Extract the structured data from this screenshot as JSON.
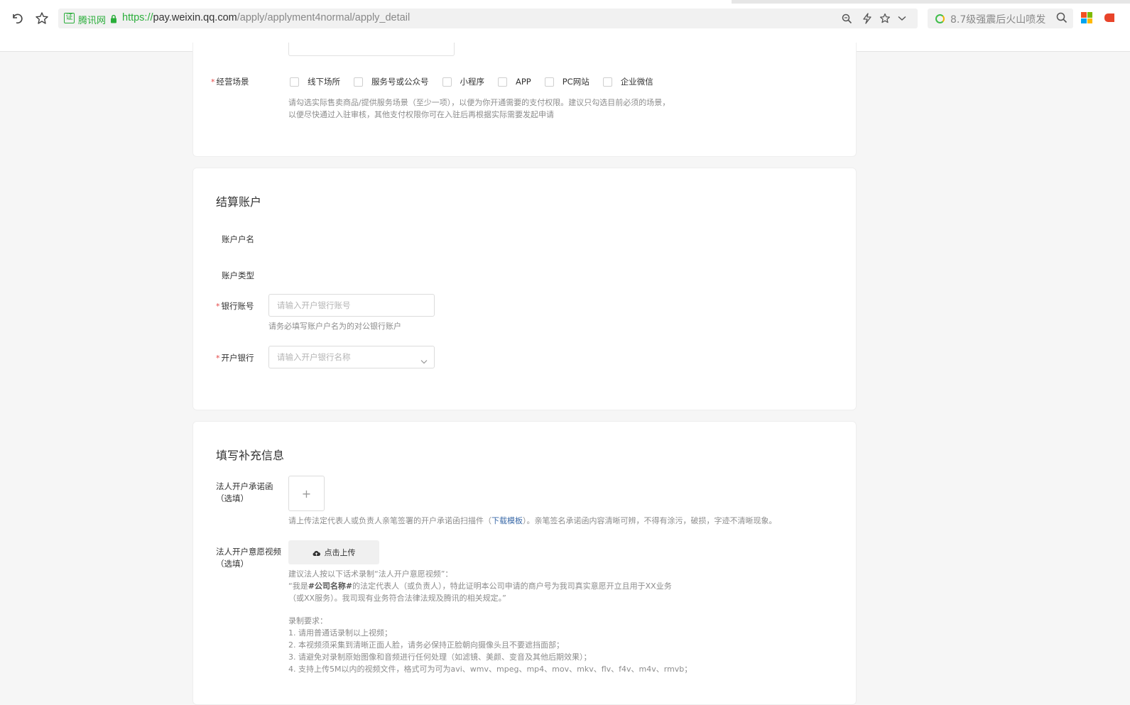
{
  "browser": {
    "cert_badge": "证",
    "cert_name": "腾讯网",
    "url_scheme": "https://",
    "url_host": "pay.weixin.qq.com",
    "url_path": "/apply/applyment4normal/apply_detail",
    "search_text": "8.7级强震后火山喷发"
  },
  "business_scene": {
    "label": "经营场景",
    "required_mark": "*",
    "options": [
      "线下场所",
      "服务号或公众号",
      "小程序",
      "APP",
      "PC网站",
      "企业微信"
    ],
    "hint_line1": "请勾选实际售卖商品/提供服务场景（至少一项），以便为你开通需要的支付权限。建议只勾选目前必须的场景，",
    "hint_line2": "以便尽快通过入驻审核，其他支付权限你可在入驻后再根据实际需要发起申请"
  },
  "settlement": {
    "title": "结算账户",
    "account_name_label": "账户户名",
    "account_type_label": "账户类型",
    "bank_account_label": "银行账号",
    "bank_account_placeholder": "请输入开户银行账号",
    "bank_account_hint": "请务必填写账户户名为的对公银行账户",
    "bank_label": "开户银行",
    "bank_placeholder": "请输入开户银行名称",
    "required_mark": "*"
  },
  "supplement": {
    "title": "填写补充信息",
    "letter_label_1": "法人开户承诺函",
    "letter_label_2": "（选填）",
    "upload_plus": "+",
    "letter_hint_before": "请上传法定代表人或负责人亲笔签署的开户承诺函扫描件（",
    "letter_hint_link": "下载模板",
    "letter_hint_after": "）。亲笔签名承诺函内容清晰可辨，不得有涂污，破损，字迹不清晰现象。",
    "video_label_1": "法人开户意愿视频",
    "video_label_2": "（选填）",
    "upload_button": "点击上传",
    "video_hint_1": "建议法人按以下话术录制“法人开户意愿视频”：",
    "video_hint_2_pre": "“我是",
    "video_hint_2_bold": "#公司名称#",
    "video_hint_2_post": "的法定代表人（或负责人），特此证明本公司申请的商户号为我司真实意愿开立且用于XX业务",
    "video_hint_3": "（或XX服务）。我司现有业务符合法律法规及腾讯的相关规定。”",
    "req_title": "录制要求：",
    "req_1": "1. 请用普通话录制以上视频；",
    "req_2": "2. 本视频须采集到清晰正面人脸，请务必保持正脸朝向摄像头且不要遮挡面部；",
    "req_3": "3. 请避免对录制原始图像和音频进行任何处理（如滤镜、美颜、变音及其他后期效果）；",
    "req_4": "4. 支持上传5M以内的视频文件，格式可为可为avi、wmv、mpeg、mp4、mov、mkv、flv、f4v、m4v、rmvb；"
  },
  "colors": {
    "brand_green": "#2aae3a",
    "required_red": "#e54545",
    "link_blue": "#3b6aa8"
  }
}
